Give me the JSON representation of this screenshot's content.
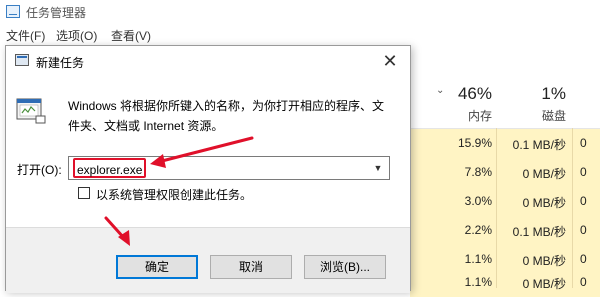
{
  "taskmanager": {
    "title": "任务管理器",
    "menu": [
      "文件(F)",
      "选项(O)",
      "查看(V)"
    ],
    "columns": [
      {
        "pct": "46%",
        "name": "内存"
      },
      {
        "pct": "1%",
        "name": "磁盘"
      }
    ],
    "rows": [
      {
        "memory": "15.9%",
        "disk": "0.1 MB/秒",
        "extra": "0"
      },
      {
        "memory": "7.8%",
        "disk": "0 MB/秒",
        "extra": "0"
      },
      {
        "memory": "3.0%",
        "disk": "0 MB/秒",
        "extra": "0"
      },
      {
        "memory": "2.2%",
        "disk": "0.1 MB/秒",
        "extra": "0"
      },
      {
        "memory": "1.1%",
        "disk": "0 MB/秒",
        "extra": "0"
      },
      {
        "memory": "1.1%",
        "disk": "0 MB/秒",
        "extra": "0"
      }
    ],
    "highlight_color": "#fff4c4"
  },
  "dialog": {
    "title": "新建任务",
    "close": "✕",
    "description": "Windows 将根据你所键入的名称，为你打开相应的程序、文件夹、文档或 Internet 资源。",
    "open_label": "打开(O):",
    "command_value": "explorer.exe",
    "dropdown_icon": "chevron-down-icon",
    "admin_checkbox_label": "以系统管理权限创建此任务。",
    "buttons": {
      "ok": "确定",
      "cancel": "取消",
      "browse": "浏览(B)..."
    }
  },
  "annotation_color": "#e0102a"
}
